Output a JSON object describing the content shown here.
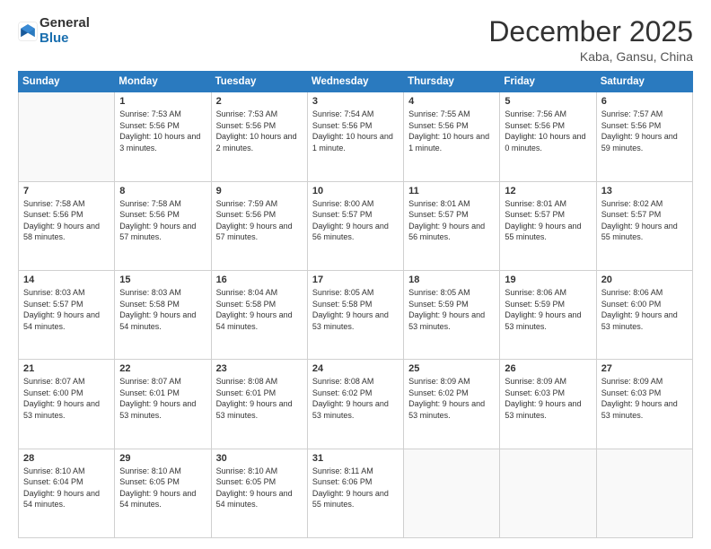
{
  "header": {
    "logo_general": "General",
    "logo_blue": "Blue",
    "month_title": "December 2025",
    "location": "Kaba, Gansu, China"
  },
  "days_of_week": [
    "Sunday",
    "Monday",
    "Tuesday",
    "Wednesday",
    "Thursday",
    "Friday",
    "Saturday"
  ],
  "weeks": [
    [
      {
        "day": "",
        "empty": true
      },
      {
        "day": "1",
        "sunrise": "7:53 AM",
        "sunset": "5:56 PM",
        "daylight": "10 hours and 3 minutes."
      },
      {
        "day": "2",
        "sunrise": "7:53 AM",
        "sunset": "5:56 PM",
        "daylight": "10 hours and 2 minutes."
      },
      {
        "day": "3",
        "sunrise": "7:54 AM",
        "sunset": "5:56 PM",
        "daylight": "10 hours and 1 minute."
      },
      {
        "day": "4",
        "sunrise": "7:55 AM",
        "sunset": "5:56 PM",
        "daylight": "10 hours and 1 minute."
      },
      {
        "day": "5",
        "sunrise": "7:56 AM",
        "sunset": "5:56 PM",
        "daylight": "10 hours and 0 minutes."
      },
      {
        "day": "6",
        "sunrise": "7:57 AM",
        "sunset": "5:56 PM",
        "daylight": "9 hours and 59 minutes."
      }
    ],
    [
      {
        "day": "7",
        "sunrise": "7:58 AM",
        "sunset": "5:56 PM",
        "daylight": "9 hours and 58 minutes."
      },
      {
        "day": "8",
        "sunrise": "7:58 AM",
        "sunset": "5:56 PM",
        "daylight": "9 hours and 57 minutes."
      },
      {
        "day": "9",
        "sunrise": "7:59 AM",
        "sunset": "5:56 PM",
        "daylight": "9 hours and 57 minutes."
      },
      {
        "day": "10",
        "sunrise": "8:00 AM",
        "sunset": "5:57 PM",
        "daylight": "9 hours and 56 minutes."
      },
      {
        "day": "11",
        "sunrise": "8:01 AM",
        "sunset": "5:57 PM",
        "daylight": "9 hours and 56 minutes."
      },
      {
        "day": "12",
        "sunrise": "8:01 AM",
        "sunset": "5:57 PM",
        "daylight": "9 hours and 55 minutes."
      },
      {
        "day": "13",
        "sunrise": "8:02 AM",
        "sunset": "5:57 PM",
        "daylight": "9 hours and 55 minutes."
      }
    ],
    [
      {
        "day": "14",
        "sunrise": "8:03 AM",
        "sunset": "5:57 PM",
        "daylight": "9 hours and 54 minutes."
      },
      {
        "day": "15",
        "sunrise": "8:03 AM",
        "sunset": "5:58 PM",
        "daylight": "9 hours and 54 minutes."
      },
      {
        "day": "16",
        "sunrise": "8:04 AM",
        "sunset": "5:58 PM",
        "daylight": "9 hours and 54 minutes."
      },
      {
        "day": "17",
        "sunrise": "8:05 AM",
        "sunset": "5:58 PM",
        "daylight": "9 hours and 53 minutes."
      },
      {
        "day": "18",
        "sunrise": "8:05 AM",
        "sunset": "5:59 PM",
        "daylight": "9 hours and 53 minutes."
      },
      {
        "day": "19",
        "sunrise": "8:06 AM",
        "sunset": "5:59 PM",
        "daylight": "9 hours and 53 minutes."
      },
      {
        "day": "20",
        "sunrise": "8:06 AM",
        "sunset": "6:00 PM",
        "daylight": "9 hours and 53 minutes."
      }
    ],
    [
      {
        "day": "21",
        "sunrise": "8:07 AM",
        "sunset": "6:00 PM",
        "daylight": "9 hours and 53 minutes."
      },
      {
        "day": "22",
        "sunrise": "8:07 AM",
        "sunset": "6:01 PM",
        "daylight": "9 hours and 53 minutes."
      },
      {
        "day": "23",
        "sunrise": "8:08 AM",
        "sunset": "6:01 PM",
        "daylight": "9 hours and 53 minutes."
      },
      {
        "day": "24",
        "sunrise": "8:08 AM",
        "sunset": "6:02 PM",
        "daylight": "9 hours and 53 minutes."
      },
      {
        "day": "25",
        "sunrise": "8:09 AM",
        "sunset": "6:02 PM",
        "daylight": "9 hours and 53 minutes."
      },
      {
        "day": "26",
        "sunrise": "8:09 AM",
        "sunset": "6:03 PM",
        "daylight": "9 hours and 53 minutes."
      },
      {
        "day": "27",
        "sunrise": "8:09 AM",
        "sunset": "6:03 PM",
        "daylight": "9 hours and 53 minutes."
      }
    ],
    [
      {
        "day": "28",
        "sunrise": "8:10 AM",
        "sunset": "6:04 PM",
        "daylight": "9 hours and 54 minutes."
      },
      {
        "day": "29",
        "sunrise": "8:10 AM",
        "sunset": "6:05 PM",
        "daylight": "9 hours and 54 minutes."
      },
      {
        "day": "30",
        "sunrise": "8:10 AM",
        "sunset": "6:05 PM",
        "daylight": "9 hours and 54 minutes."
      },
      {
        "day": "31",
        "sunrise": "8:11 AM",
        "sunset": "6:06 PM",
        "daylight": "9 hours and 55 minutes."
      },
      {
        "day": "",
        "empty": true
      },
      {
        "day": "",
        "empty": true
      },
      {
        "day": "",
        "empty": true
      }
    ]
  ],
  "labels": {
    "sunrise": "Sunrise:",
    "sunset": "Sunset:",
    "daylight": "Daylight:"
  }
}
